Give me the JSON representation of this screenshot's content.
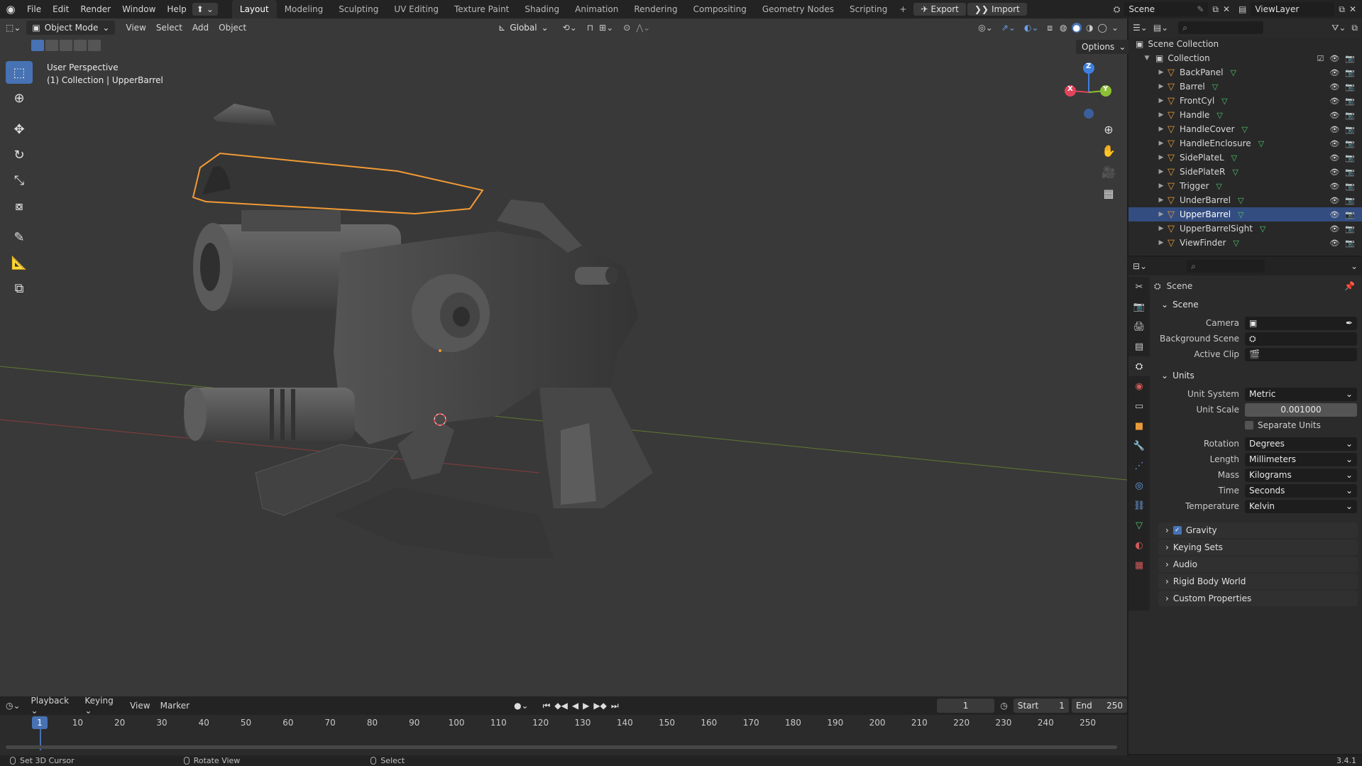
{
  "topbar": {
    "menus": [
      "File",
      "Edit",
      "Render",
      "Window",
      "Help"
    ],
    "workspaces": [
      "Layout",
      "Modeling",
      "Sculpting",
      "UV Editing",
      "Texture Paint",
      "Shading",
      "Animation",
      "Rendering",
      "Compositing",
      "Geometry Nodes",
      "Scripting"
    ],
    "add_tab": "+",
    "export_label": "Export",
    "import_label": "Import",
    "scene_name": "Scene",
    "view_layer": "ViewLayer"
  },
  "viewport_header": {
    "mode": "Object Mode",
    "menus": [
      "View",
      "Select",
      "Add",
      "Object"
    ],
    "transform_orientation": "Global",
    "options_label": "Options"
  },
  "viewport": {
    "overlay_line1": "User Perspective",
    "overlay_line2": "(1) Collection | UpperBarrel",
    "gizmo_axes": {
      "x": "X",
      "y": "Y",
      "z": "Z"
    },
    "axis_colors": {
      "x": "#e2445a",
      "y": "#8cbf36",
      "z": "#3f7fe0"
    },
    "selection_color": "#f29a35"
  },
  "outliner": {
    "root": "Scene Collection",
    "collection": "Collection",
    "items": [
      {
        "name": "BackPanel",
        "selected": false
      },
      {
        "name": "Barrel",
        "selected": false
      },
      {
        "name": "FrontCyl",
        "selected": false
      },
      {
        "name": "Handle",
        "selected": false
      },
      {
        "name": "HandleCover",
        "selected": false
      },
      {
        "name": "HandleEnclosure",
        "selected": false
      },
      {
        "name": "SidePlateL",
        "selected": false
      },
      {
        "name": "SidePlateR",
        "selected": false
      },
      {
        "name": "Trigger",
        "selected": false
      },
      {
        "name": "UnderBarrel",
        "selected": false
      },
      {
        "name": "UpperBarrel",
        "selected": true
      },
      {
        "name": "UpperBarrelSight",
        "selected": false
      },
      {
        "name": "ViewFinder",
        "selected": false
      }
    ]
  },
  "properties": {
    "context_title": "Scene",
    "scene_section": "Scene",
    "camera_label": "Camera",
    "background_scene_label": "Background Scene",
    "active_clip_label": "Active Clip",
    "units_section": "Units",
    "unit_system_label": "Unit System",
    "unit_system_value": "Metric",
    "unit_scale_label": "Unit Scale",
    "unit_scale_value": "0.001000",
    "separate_units_label": "Separate Units",
    "rotation_label": "Rotation",
    "rotation_value": "Degrees",
    "length_label": "Length",
    "length_value": "Millimeters",
    "mass_label": "Mass",
    "mass_value": "Kilograms",
    "time_label": "Time",
    "time_value": "Seconds",
    "temperature_label": "Temperature",
    "temperature_value": "Kelvin",
    "collapsed_sections": [
      "Gravity",
      "Keying Sets",
      "Audio",
      "Rigid Body World",
      "Custom Properties"
    ]
  },
  "timeline": {
    "menus": [
      "Playback",
      "Keying",
      "View",
      "Marker"
    ],
    "current_frame": "1",
    "start_label": "Start",
    "start_value": "1",
    "end_label": "End",
    "end_value": "250",
    "ruler": [
      "10",
      "20",
      "30",
      "40",
      "50",
      "60",
      "70",
      "80",
      "90",
      "100",
      "110",
      "120",
      "130",
      "140",
      "150",
      "160",
      "170",
      "180",
      "190",
      "200",
      "210",
      "220",
      "230",
      "240",
      "250"
    ],
    "playhead_label": "1"
  },
  "statusbar": {
    "left_click": "Set 3D Cursor",
    "middle_click": "Rotate View",
    "right_click": "Select",
    "version": "3.4.1"
  }
}
